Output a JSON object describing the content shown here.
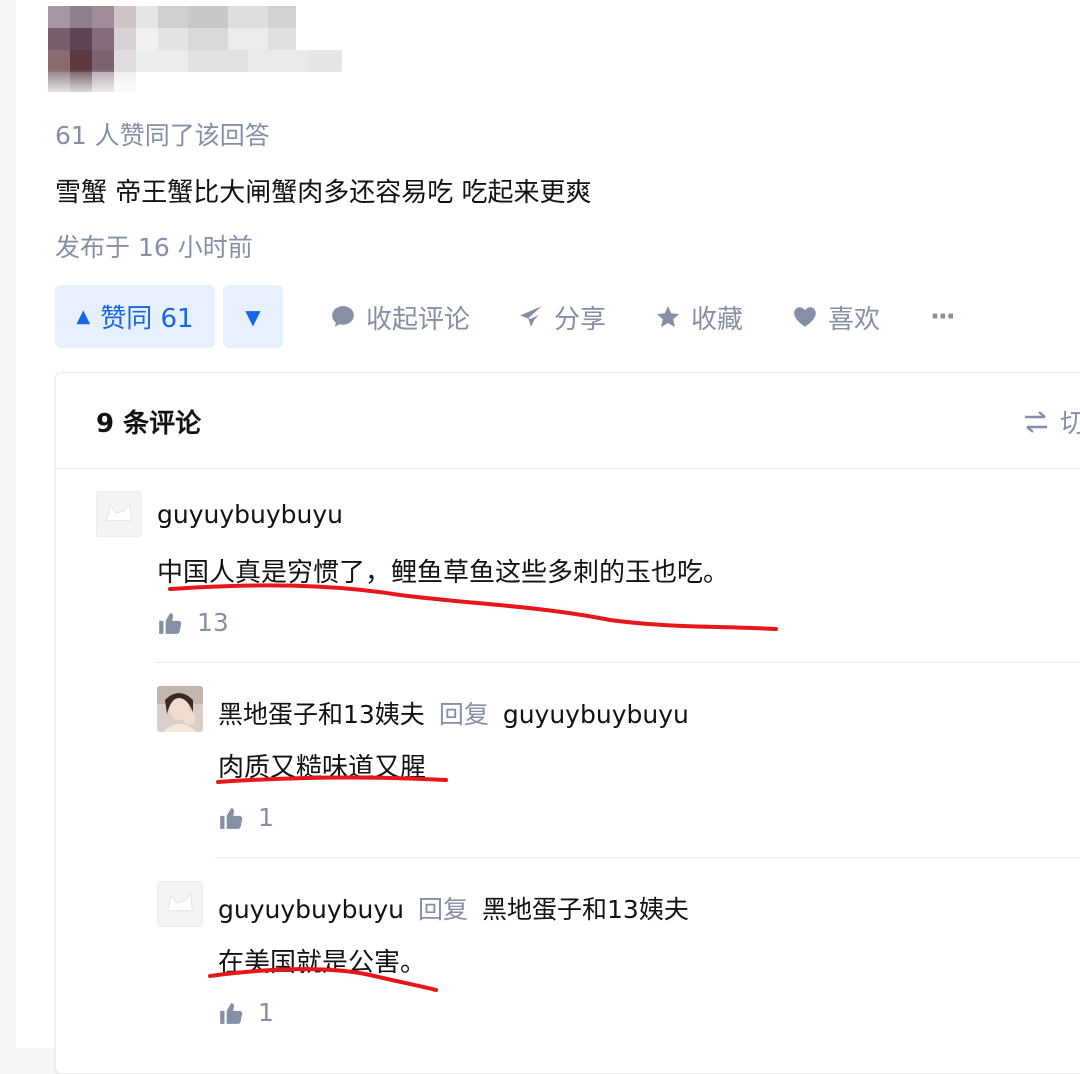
{
  "answer": {
    "votes_meta": "61 人赞同了该回答",
    "text": "雪蟹 帝王蟹比大闸蟹肉多还容易吃 吃起来更爽",
    "published": "发布于 16 小时前"
  },
  "actions": {
    "upvote_label": "赞同 61",
    "collapse_comments": "收起评论",
    "share": "分享",
    "favorite": "收藏",
    "like": "喜欢",
    "more": "···"
  },
  "comments": {
    "count_label": "9 条评论",
    "switch_label": "切",
    "reply_word": "回复",
    "items": [
      {
        "author": "guyuybuybuyu",
        "text": "中国人真是穷惯了，鲤鱼草鱼这些多刺的玉也吃。",
        "likes": "13"
      },
      {
        "author": "黑地蛋子和13姨夫",
        "reply_to": "guyuybuybuyu",
        "text": "肉质又糙味道又腥",
        "likes": "1"
      },
      {
        "author": "guyuybuybuyu",
        "reply_to": "黑地蛋子和13姨夫",
        "text": "在美国就是公害。",
        "likes": "1"
      }
    ]
  },
  "colors": {
    "accent": "#1766e8",
    "accent_bg": "#e8f0fd",
    "muted": "#8590a6",
    "annotation_red": "#e8161b"
  }
}
